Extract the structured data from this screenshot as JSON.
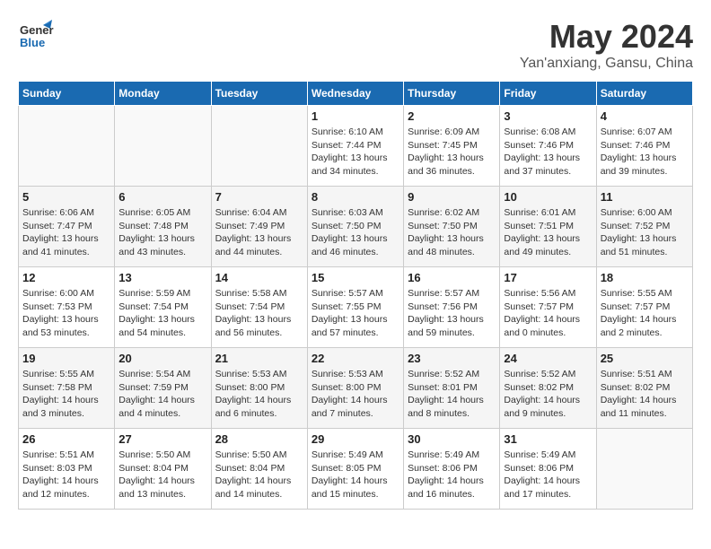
{
  "logo": {
    "line1": "General",
    "line2": "Blue"
  },
  "title": "May 2024",
  "subtitle": "Yan'anxiang, Gansu, China",
  "headers": [
    "Sunday",
    "Monday",
    "Tuesday",
    "Wednesday",
    "Thursday",
    "Friday",
    "Saturday"
  ],
  "weeks": [
    [
      {
        "day": "",
        "info": ""
      },
      {
        "day": "",
        "info": ""
      },
      {
        "day": "",
        "info": ""
      },
      {
        "day": "1",
        "info": "Sunrise: 6:10 AM\nSunset: 7:44 PM\nDaylight: 13 hours\nand 34 minutes."
      },
      {
        "day": "2",
        "info": "Sunrise: 6:09 AM\nSunset: 7:45 PM\nDaylight: 13 hours\nand 36 minutes."
      },
      {
        "day": "3",
        "info": "Sunrise: 6:08 AM\nSunset: 7:46 PM\nDaylight: 13 hours\nand 37 minutes."
      },
      {
        "day": "4",
        "info": "Sunrise: 6:07 AM\nSunset: 7:46 PM\nDaylight: 13 hours\nand 39 minutes."
      }
    ],
    [
      {
        "day": "5",
        "info": "Sunrise: 6:06 AM\nSunset: 7:47 PM\nDaylight: 13 hours\nand 41 minutes."
      },
      {
        "day": "6",
        "info": "Sunrise: 6:05 AM\nSunset: 7:48 PM\nDaylight: 13 hours\nand 43 minutes."
      },
      {
        "day": "7",
        "info": "Sunrise: 6:04 AM\nSunset: 7:49 PM\nDaylight: 13 hours\nand 44 minutes."
      },
      {
        "day": "8",
        "info": "Sunrise: 6:03 AM\nSunset: 7:50 PM\nDaylight: 13 hours\nand 46 minutes."
      },
      {
        "day": "9",
        "info": "Sunrise: 6:02 AM\nSunset: 7:50 PM\nDaylight: 13 hours\nand 48 minutes."
      },
      {
        "day": "10",
        "info": "Sunrise: 6:01 AM\nSunset: 7:51 PM\nDaylight: 13 hours\nand 49 minutes."
      },
      {
        "day": "11",
        "info": "Sunrise: 6:00 AM\nSunset: 7:52 PM\nDaylight: 13 hours\nand 51 minutes."
      }
    ],
    [
      {
        "day": "12",
        "info": "Sunrise: 6:00 AM\nSunset: 7:53 PM\nDaylight: 13 hours\nand 53 minutes."
      },
      {
        "day": "13",
        "info": "Sunrise: 5:59 AM\nSunset: 7:54 PM\nDaylight: 13 hours\nand 54 minutes."
      },
      {
        "day": "14",
        "info": "Sunrise: 5:58 AM\nSunset: 7:54 PM\nDaylight: 13 hours\nand 56 minutes."
      },
      {
        "day": "15",
        "info": "Sunrise: 5:57 AM\nSunset: 7:55 PM\nDaylight: 13 hours\nand 57 minutes."
      },
      {
        "day": "16",
        "info": "Sunrise: 5:57 AM\nSunset: 7:56 PM\nDaylight: 13 hours\nand 59 minutes."
      },
      {
        "day": "17",
        "info": "Sunrise: 5:56 AM\nSunset: 7:57 PM\nDaylight: 14 hours\nand 0 minutes."
      },
      {
        "day": "18",
        "info": "Sunrise: 5:55 AM\nSunset: 7:57 PM\nDaylight: 14 hours\nand 2 minutes."
      }
    ],
    [
      {
        "day": "19",
        "info": "Sunrise: 5:55 AM\nSunset: 7:58 PM\nDaylight: 14 hours\nand 3 minutes."
      },
      {
        "day": "20",
        "info": "Sunrise: 5:54 AM\nSunset: 7:59 PM\nDaylight: 14 hours\nand 4 minutes."
      },
      {
        "day": "21",
        "info": "Sunrise: 5:53 AM\nSunset: 8:00 PM\nDaylight: 14 hours\nand 6 minutes."
      },
      {
        "day": "22",
        "info": "Sunrise: 5:53 AM\nSunset: 8:00 PM\nDaylight: 14 hours\nand 7 minutes."
      },
      {
        "day": "23",
        "info": "Sunrise: 5:52 AM\nSunset: 8:01 PM\nDaylight: 14 hours\nand 8 minutes."
      },
      {
        "day": "24",
        "info": "Sunrise: 5:52 AM\nSunset: 8:02 PM\nDaylight: 14 hours\nand 9 minutes."
      },
      {
        "day": "25",
        "info": "Sunrise: 5:51 AM\nSunset: 8:02 PM\nDaylight: 14 hours\nand 11 minutes."
      }
    ],
    [
      {
        "day": "26",
        "info": "Sunrise: 5:51 AM\nSunset: 8:03 PM\nDaylight: 14 hours\nand 12 minutes."
      },
      {
        "day": "27",
        "info": "Sunrise: 5:50 AM\nSunset: 8:04 PM\nDaylight: 14 hours\nand 13 minutes."
      },
      {
        "day": "28",
        "info": "Sunrise: 5:50 AM\nSunset: 8:04 PM\nDaylight: 14 hours\nand 14 minutes."
      },
      {
        "day": "29",
        "info": "Sunrise: 5:49 AM\nSunset: 8:05 PM\nDaylight: 14 hours\nand 15 minutes."
      },
      {
        "day": "30",
        "info": "Sunrise: 5:49 AM\nSunset: 8:06 PM\nDaylight: 14 hours\nand 16 minutes."
      },
      {
        "day": "31",
        "info": "Sunrise: 5:49 AM\nSunset: 8:06 PM\nDaylight: 14 hours\nand 17 minutes."
      },
      {
        "day": "",
        "info": ""
      }
    ]
  ]
}
